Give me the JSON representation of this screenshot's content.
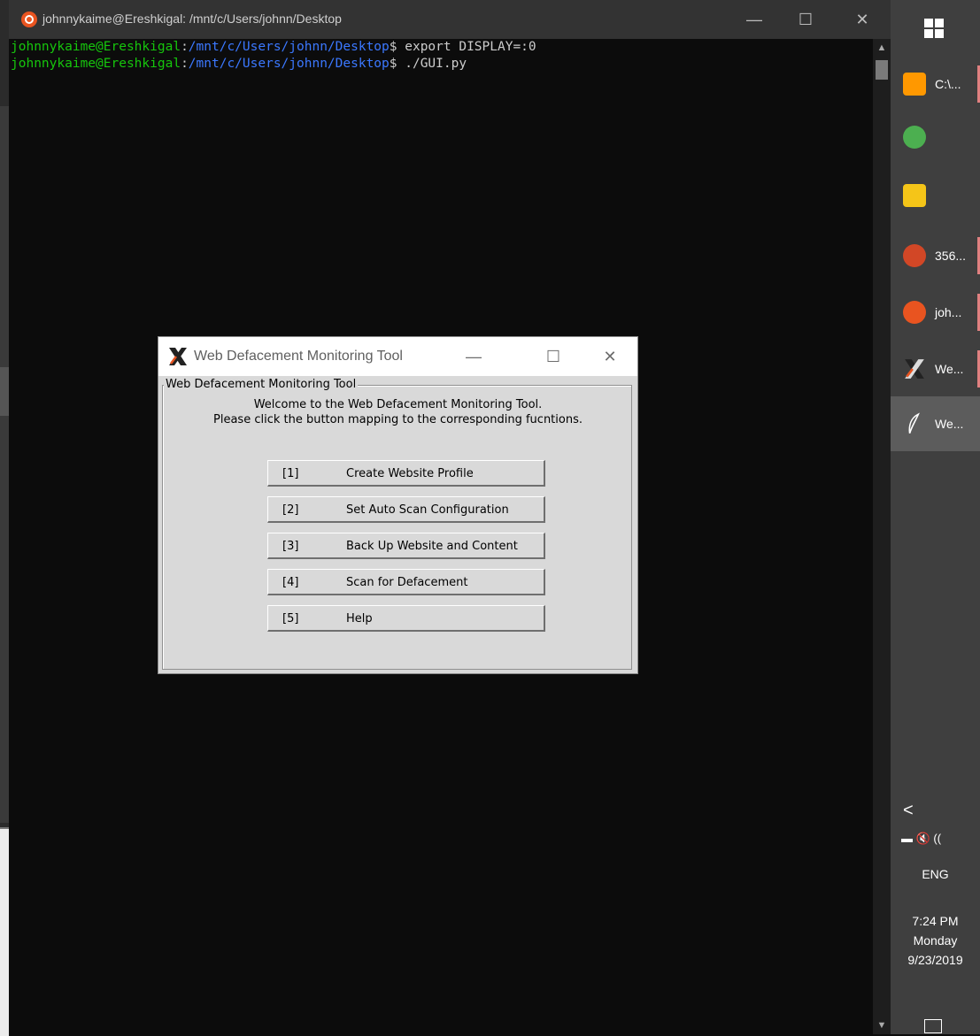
{
  "terminal": {
    "title": "johnnykaime@Ereshkigal: /mnt/c/Users/johnn/Desktop",
    "lines": [
      {
        "user": "johnnykaime@Ereshkigal",
        "sep": ":",
        "path": "/mnt/c/Users/johnn/Desktop",
        "cmd": "$ export DISPLAY=:0"
      },
      {
        "user": "johnnykaime@Ereshkigal",
        "sep": ":",
        "path": "/mnt/c/Users/johnn/Desktop",
        "cmd": "$ ./GUI.py"
      }
    ],
    "controls": {
      "minimize": "—",
      "maximize": "☐",
      "close": "✕"
    },
    "scroll": {
      "up": "▲",
      "down": "▼"
    }
  },
  "dialog": {
    "title": "Web Defacement Monitoring Tool",
    "controls": {
      "minimize": "—",
      "maximize": "☐",
      "close": "✕"
    },
    "frame_label": "Web Defacement Monitoring Tool",
    "welcome_line1": "Welcome to the Web Defacement Monitoring Tool.",
    "welcome_line2": "Please click the button mapping to the corresponding fucntions.",
    "buttons": [
      {
        "num": "[1]",
        "label": "Create Website Profile"
      },
      {
        "num": "[2]",
        "label": "Set Auto Scan Configuration"
      },
      {
        "num": "[3]",
        "label": "Back Up Website and Content"
      },
      {
        "num": "[4]",
        "label": "Scan for Defacement"
      },
      {
        "num": "[5]",
        "label": "Help"
      }
    ]
  },
  "taskbar": {
    "items": [
      {
        "icon": "sublime-text-icon",
        "label": "C:\\...",
        "color": "#ff9800"
      },
      {
        "icon": "chrome-icon",
        "label": "",
        "color": "#4caf50"
      },
      {
        "icon": "kmplayer-icon",
        "label": "",
        "color": "#f5c518"
      },
      {
        "icon": "powerpoint-icon",
        "label": "356...",
        "color": "#d24726"
      },
      {
        "icon": "ubuntu-icon",
        "label": "joh...",
        "color": "#e95420"
      },
      {
        "icon": "xming-icon",
        "label": "We...",
        "color": "#333333"
      },
      {
        "icon": "feather-icon",
        "label": "We...",
        "color": "#5c5c5c"
      }
    ],
    "tray": {
      "chevron": "<",
      "icons": "▬ 🔇 ((",
      "language": "ENG"
    },
    "clock": {
      "time": "7:24 PM",
      "day": "Monday",
      "date": "9/23/2019"
    }
  }
}
